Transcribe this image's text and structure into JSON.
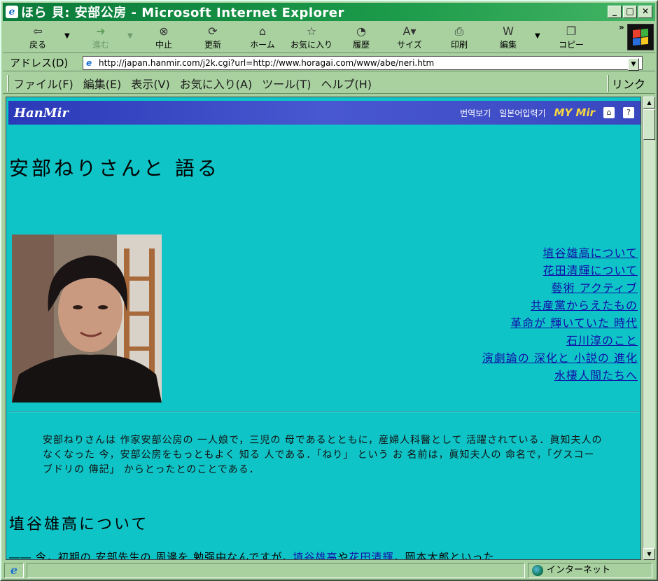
{
  "window": {
    "title": "ほら 貝: 安部公房 - Microsoft Internet Explorer",
    "icon": "ie-icon"
  },
  "toolbar": {
    "buttons": [
      {
        "label": "戻る",
        "icon": "back-arrow-icon"
      },
      {
        "label": "進む",
        "icon": "forward-arrow-icon"
      },
      {
        "label": "中止",
        "icon": "stop-icon"
      },
      {
        "label": "更新",
        "icon": "refresh-icon"
      },
      {
        "label": "ホーム",
        "icon": "home-icon"
      },
      {
        "label": "お気に入り",
        "icon": "favorites-icon"
      },
      {
        "label": "履歴",
        "icon": "history-icon"
      },
      {
        "label": "サイズ",
        "icon": "font-size-icon"
      },
      {
        "label": "印刷",
        "icon": "print-icon"
      },
      {
        "label": "編集",
        "icon": "edit-icon"
      },
      {
        "label": "コピー",
        "icon": "copy-icon"
      }
    ],
    "overflow": "»"
  },
  "address": {
    "label": "アドレス(D)",
    "url": "http://japan.hanmir.com/j2k.cgi?url=http://www.horagai.com/www/abe/neri.htm"
  },
  "menu": {
    "items": [
      "ファイル(F)",
      "編集(E)",
      "表示(V)",
      "お気に入り(A)",
      "ツール(T)",
      "ヘルプ(H)"
    ],
    "links": "リンク"
  },
  "banner": {
    "logo": "HanMir",
    "link1": "번역보기",
    "link2": "일본어입력기",
    "mymir": "MY Mir"
  },
  "page": {
    "title": "安部ねりさんと 語る",
    "links": [
      "埴谷雄高について",
      "花田清輝について",
      "藝術 アクティブ",
      "共産黨からえたもの",
      "革命が 輝いていた 時代",
      "石川淳のこと",
      "演劇論の 深化と 小説の 進化",
      "水棲人間たちへ"
    ],
    "intro": "安部ねりさんは 作家安部公房の 一人娘で，三児の 母であるとともに，産婦人科醫として 活躍されている．眞知夫人のなくなった 今，安部公房をもっともよく 知る 人である．「ねり」 という お 名前は，眞知夫人の 命名で，「グスコーブドリの 傳記」 からとったとのことである．",
    "section_heading": "埴谷雄高について",
    "para_start": "―― 今，初期の 安部先生の 周邊を 勉强中なんですが，",
    "para_link1": "埴谷雄高",
    "para_mid": "や",
    "para_link2": "花田清輝",
    "para_end": "，岡本太郎といった"
  },
  "status": {
    "zone": "インターネット"
  }
}
